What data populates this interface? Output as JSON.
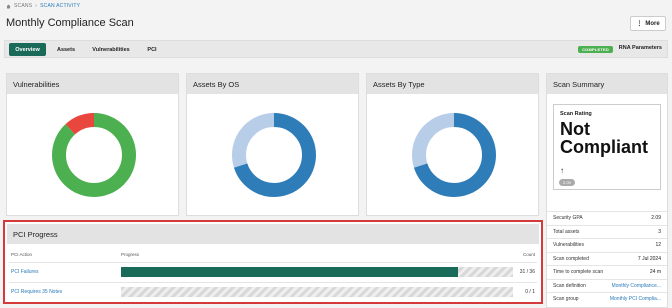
{
  "breadcrumb": {
    "root": "SCANS",
    "separator": "›",
    "current": "SCAN ACTIVITY"
  },
  "title": "Monthly Compliance Scan",
  "more_button": {
    "label": "More"
  },
  "tabs": [
    {
      "label": "Overview",
      "active": true
    },
    {
      "label": "Assets"
    },
    {
      "label": "Vulnerabilities"
    },
    {
      "label": "PCI"
    }
  ],
  "status_badge": "COMPLETED",
  "rna_parameters": "RNA Parameters",
  "cards": {
    "vulnerabilities": {
      "title": "Vulnerabilities"
    },
    "assets_by_os": {
      "title": "Assets By OS"
    },
    "assets_by_type": {
      "title": "Assets By Type"
    }
  },
  "chart_data": [
    {
      "type": "pie",
      "slices": [
        {
          "value": 0.88,
          "color": "#4caf50"
        },
        {
          "value": 0.12,
          "color": "#e9473e"
        }
      ]
    },
    {
      "type": "pie",
      "slices": [
        {
          "value": 0.7,
          "color": "#2e7cb8"
        },
        {
          "value": 0.3,
          "color": "#b7cde8"
        }
      ]
    },
    {
      "type": "pie",
      "slices": [
        {
          "value": 0.7,
          "color": "#2e7cb8"
        },
        {
          "value": 0.3,
          "color": "#b7cde8"
        }
      ]
    }
  ],
  "scan_summary": {
    "title": "Scan Summary",
    "rating_label": "Scan Rating",
    "rating_value": "Not Compliant",
    "rating_arrow": "↑",
    "rating_score": "2.09",
    "rows": [
      {
        "label": "Security GPA",
        "value": "2.09"
      },
      {
        "label": "Total assets",
        "value": "3"
      },
      {
        "label": "Vulnerabilities",
        "value": "12"
      },
      {
        "label": "Scan completed",
        "value": "7 Jul 2024"
      },
      {
        "label": "Time to complete scan",
        "value": "24 m"
      },
      {
        "label": "Scan definition",
        "value": "Monthly Compliance...",
        "link": true
      },
      {
        "label": "Scan group",
        "value": "Monthly PCI Complia...",
        "link": true
      }
    ]
  },
  "pci_progress": {
    "title": "PCI Progress",
    "columns": {
      "action": "PCI Action",
      "progress": "Progress",
      "count": "Count"
    },
    "rows": [
      {
        "label": "PCI Failures",
        "progress": 0.86,
        "count": "31 / 36"
      },
      {
        "label": "PCI Requires 35 Notes",
        "progress": 0.0,
        "count": "0 / 1"
      }
    ]
  },
  "colors": {
    "accent": "#1a6a5a",
    "link": "#2a7ab8",
    "highlight": "#d43a3a"
  }
}
